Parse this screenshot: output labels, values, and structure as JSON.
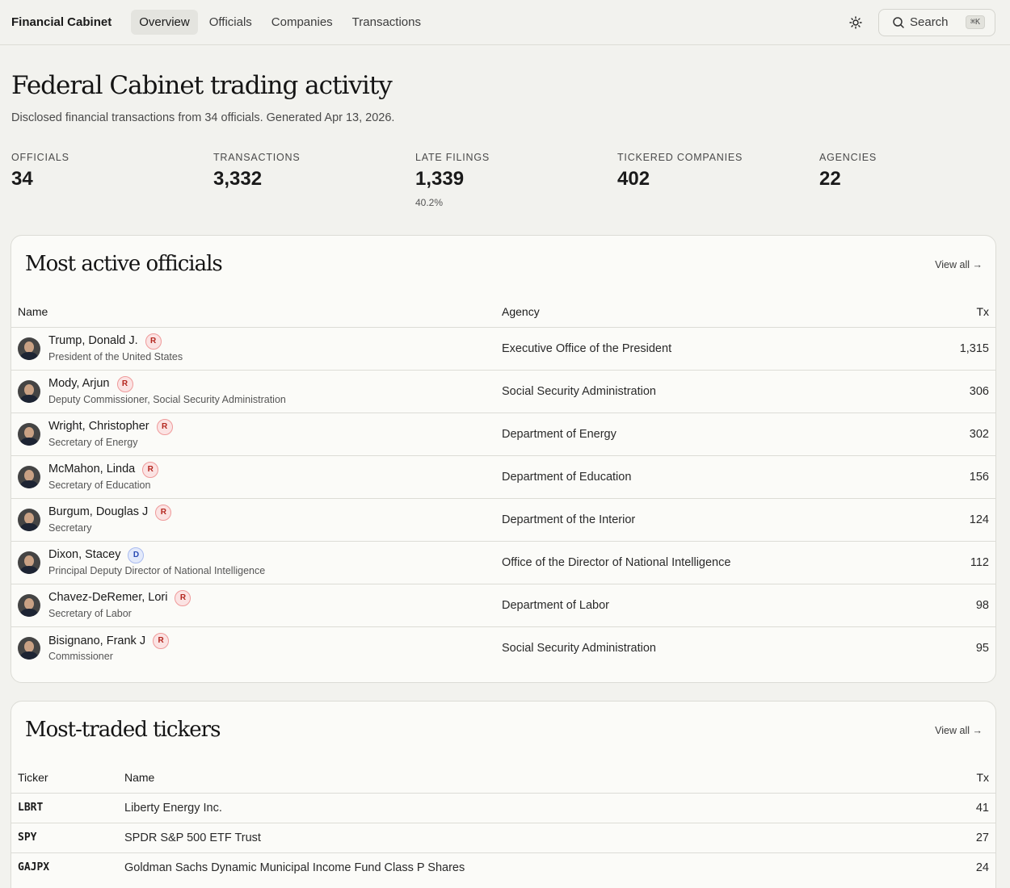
{
  "nav": {
    "brand": "Financial Cabinet",
    "items": [
      {
        "label": "Overview",
        "active": true
      },
      {
        "label": "Officials",
        "active": false
      },
      {
        "label": "Companies",
        "active": false
      },
      {
        "label": "Transactions",
        "active": false
      }
    ],
    "theme_icon": "sun-icon",
    "search_label": "Search",
    "search_shortcut": "⌘K"
  },
  "header": {
    "title": "Federal Cabinet trading activity",
    "subtitle": "Disclosed financial transactions from 34 officials. Generated Apr 13, 2026."
  },
  "stats": [
    {
      "label": "OFFICIALS",
      "value": "34",
      "sub": ""
    },
    {
      "label": "TRANSACTIONS",
      "value": "3,332",
      "sub": ""
    },
    {
      "label": "LATE FILINGS",
      "value": "1,339",
      "sub": "40.2%"
    },
    {
      "label": "TICKERED COMPANIES",
      "value": "402",
      "sub": ""
    },
    {
      "label": "AGENCIES",
      "value": "22",
      "sub": ""
    }
  ],
  "officials_card": {
    "title": "Most active officials",
    "view_all": "View all →",
    "columns": {
      "name": "Name",
      "agency": "Agency",
      "tx": "Tx"
    },
    "rows": [
      {
        "name": "Trump, Donald J.",
        "party": "R",
        "title": "President of the United States",
        "agency": "Executive Office of the President",
        "tx": "1,315"
      },
      {
        "name": "Mody, Arjun",
        "party": "R",
        "title": "Deputy Commissioner, Social Security Administration",
        "agency": "Social Security Administration",
        "tx": "306"
      },
      {
        "name": "Wright, Christopher",
        "party": "R",
        "title": "Secretary of Energy",
        "agency": "Department of Energy",
        "tx": "302"
      },
      {
        "name": "McMahon, Linda",
        "party": "R",
        "title": "Secretary of Education",
        "agency": "Department of Education",
        "tx": "156"
      },
      {
        "name": "Burgum, Douglas J",
        "party": "R",
        "title": "Secretary",
        "agency": "Department of the Interior",
        "tx": "124"
      },
      {
        "name": "Dixon, Stacey",
        "party": "D",
        "title": "Principal Deputy Director of National Intelligence",
        "agency": "Office of the Director of National Intelligence",
        "tx": "112"
      },
      {
        "name": "Chavez-DeRemer, Lori",
        "party": "R",
        "title": "Secretary of Labor",
        "agency": "Department of Labor",
        "tx": "98"
      },
      {
        "name": "Bisignano, Frank J",
        "party": "R",
        "title": "Commissioner",
        "agency": "Social Security Administration",
        "tx": "95"
      }
    ]
  },
  "tickers_card": {
    "title": "Most-traded tickers",
    "view_all": "View all →",
    "columns": {
      "ticker": "Ticker",
      "name": "Name",
      "tx": "Tx"
    },
    "rows": [
      {
        "ticker": "LBRT",
        "name": "Liberty Energy Inc.",
        "tx": "41"
      },
      {
        "ticker": "SPY",
        "name": "SPDR S&P 500 ETF Trust",
        "tx": "27"
      },
      {
        "ticker": "GAJPX",
        "name": "Goldman Sachs Dynamic Municipal Income Fund Class P Shares",
        "tx": "24"
      }
    ]
  }
}
